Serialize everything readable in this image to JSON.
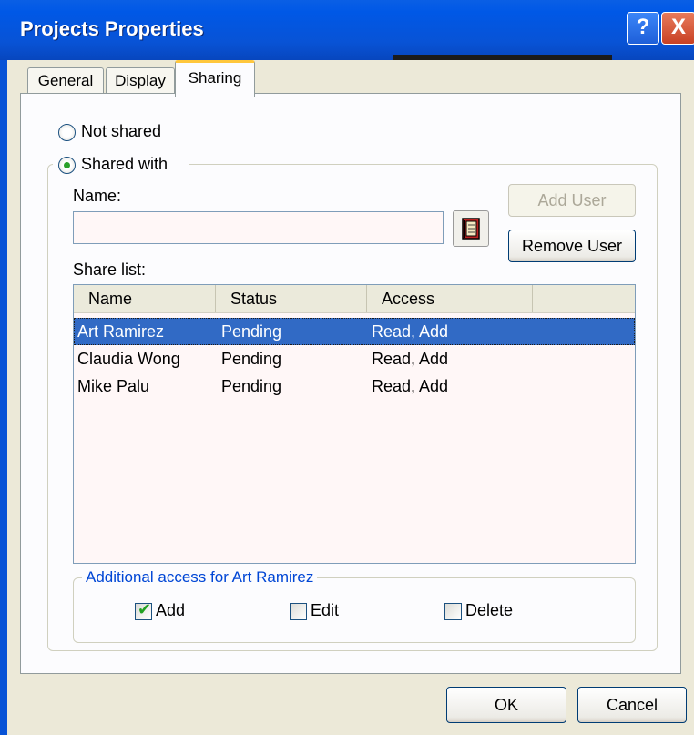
{
  "window": {
    "title": "Projects Properties",
    "help_glyph": "?",
    "close_glyph": "X"
  },
  "tabs": [
    {
      "label": "General",
      "active": false
    },
    {
      "label": "Display",
      "active": false
    },
    {
      "label": "Sharing",
      "active": true
    }
  ],
  "sharing": {
    "option_not_shared": "Not shared",
    "option_shared_with": "Shared with",
    "selected_option": "Shared with",
    "name_label": "Name:",
    "name_value": "",
    "add_user_label": "Add User",
    "add_user_enabled": false,
    "remove_user_label": "Remove User",
    "share_list_label": "Share list:",
    "columns": [
      "Name",
      "Status",
      "Access"
    ],
    "rows": [
      {
        "name": "Art Ramirez",
        "status": "Pending",
        "access": "Read, Add",
        "selected": true
      },
      {
        "name": "Claudia Wong",
        "status": "Pending",
        "access": "Read, Add",
        "selected": false
      },
      {
        "name": "Mike Palu",
        "status": "Pending",
        "access": "Read, Add",
        "selected": false
      }
    ],
    "additional_access_title": "Additional access for Art Ramirez",
    "permissions": [
      {
        "label": "Add",
        "checked": true
      },
      {
        "label": "Edit",
        "checked": false
      },
      {
        "label": "Delete",
        "checked": false
      }
    ]
  },
  "footer": {
    "ok_label": "OK",
    "cancel_label": "Cancel"
  },
  "colors": {
    "titlebar": "#0853D6",
    "selection": "#316AC5",
    "group_title": "#0046D5",
    "check": "#21A121"
  },
  "icons": {
    "address_book_button": "address-book-icon"
  }
}
